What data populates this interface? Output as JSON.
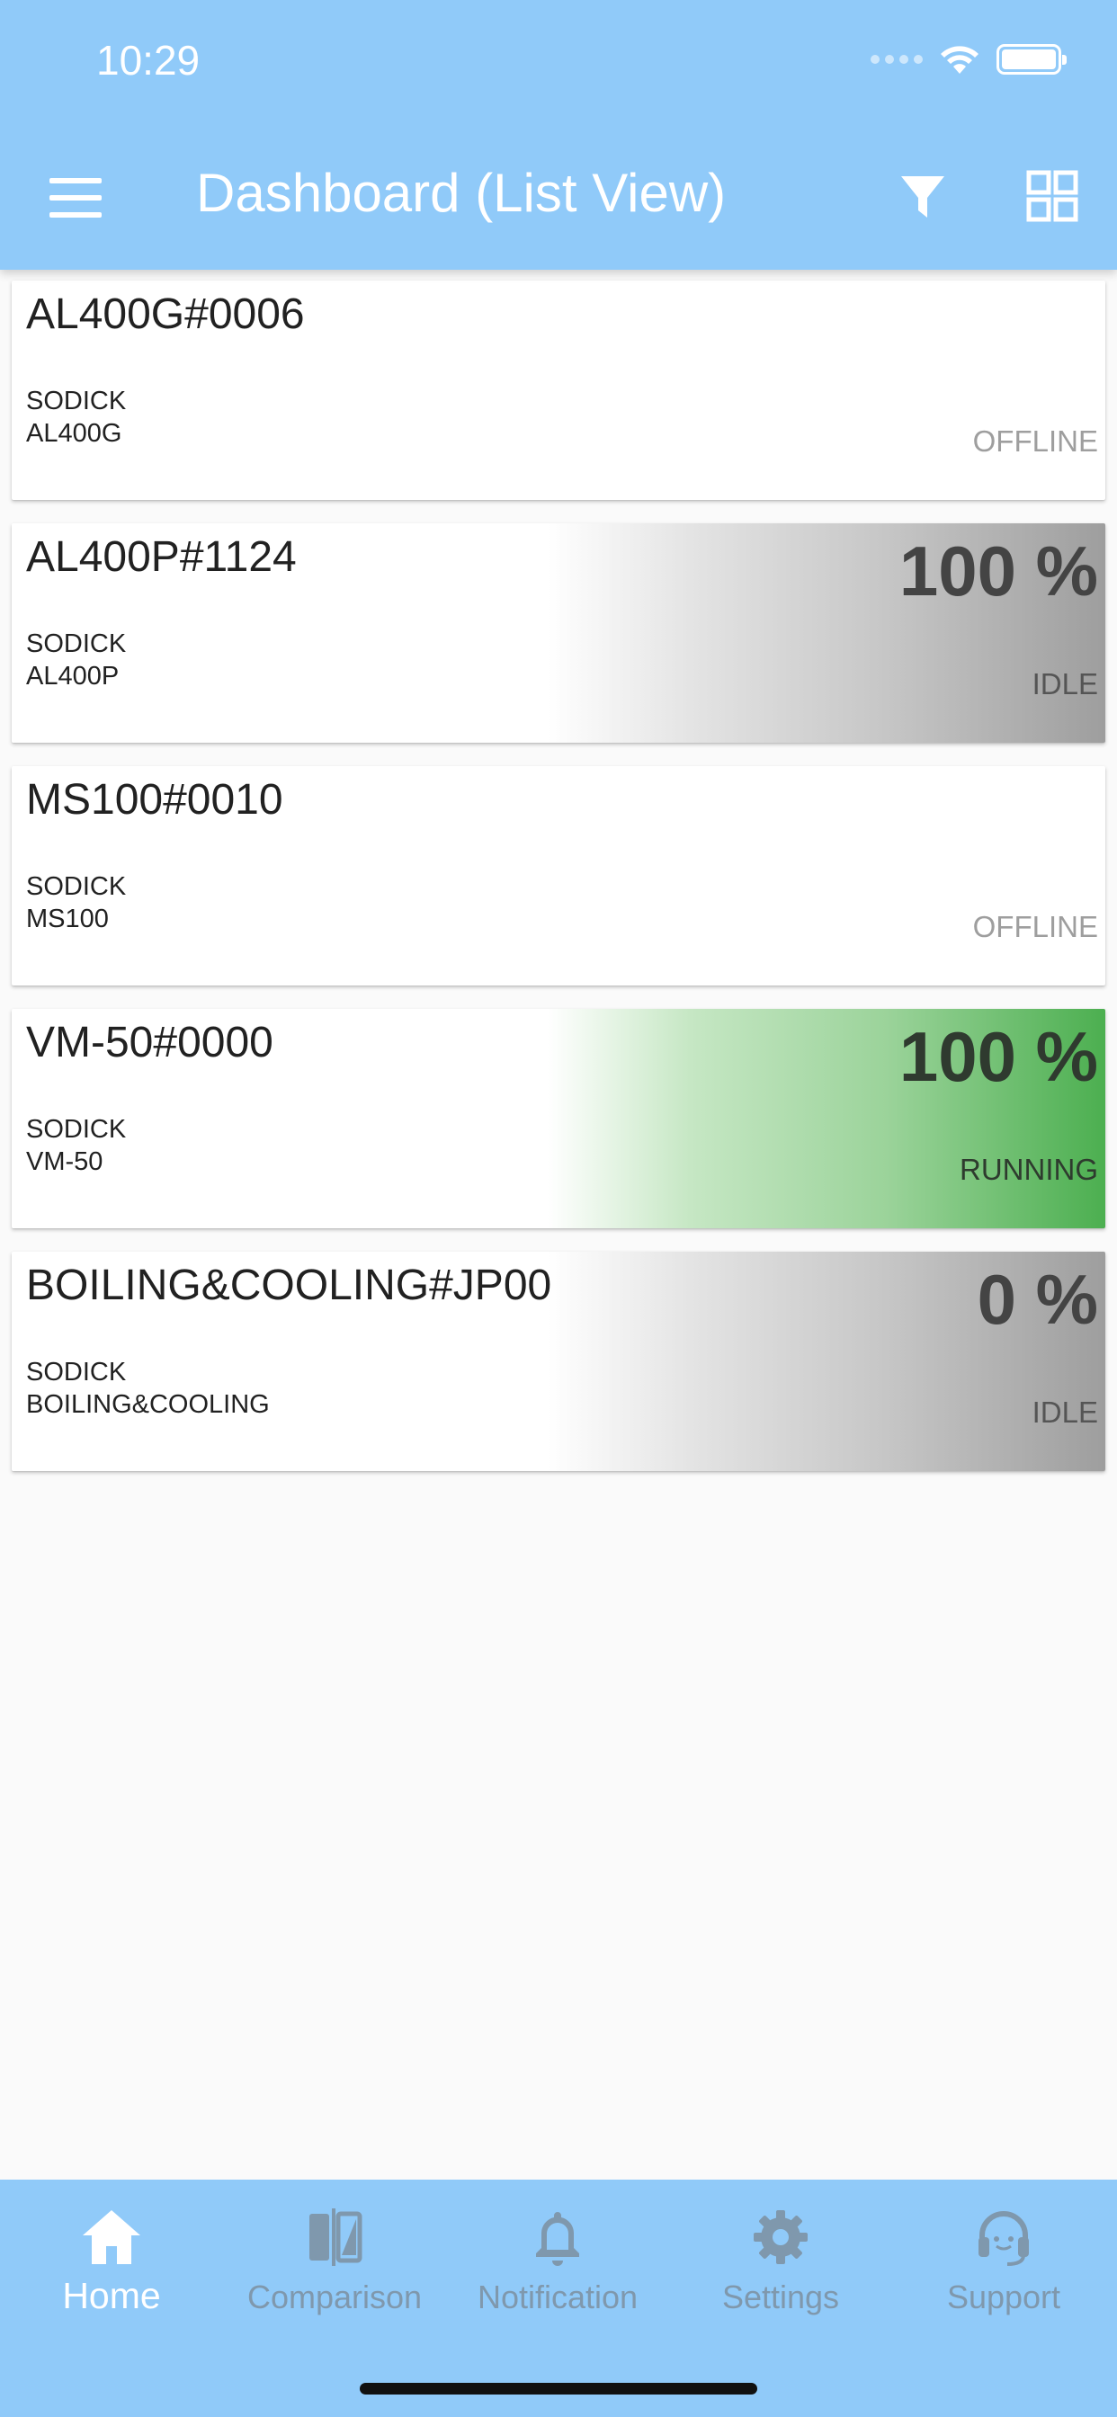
{
  "status_bar": {
    "time": "10:29"
  },
  "app_bar": {
    "title": "Dashboard (List View)",
    "menu_icon": "hamburger-menu-icon",
    "filter_icon": "filter-funnel-icon",
    "view_icon": "grid-view-icon"
  },
  "colors": {
    "primary": "#90caf9",
    "running": "#4caf50",
    "idle": "#9e9e9e",
    "background": "#fafafa"
  },
  "machines": [
    {
      "name": "AL400G#0006",
      "maker": "SODICK",
      "model": "AL400G",
      "percent": "",
      "status": "OFFLINE",
      "state": "offline"
    },
    {
      "name": "AL400P#1124",
      "maker": "SODICK",
      "model": "AL400P",
      "percent": "100 %",
      "status": "IDLE",
      "state": "idle"
    },
    {
      "name": "MS100#0010",
      "maker": "SODICK",
      "model": "MS100",
      "percent": "",
      "status": "OFFLINE",
      "state": "offline"
    },
    {
      "name": "VM-50#0000",
      "maker": "SODICK",
      "model": "VM-50",
      "percent": "100 %",
      "status": "RUNNING",
      "state": "running"
    },
    {
      "name": "BOILING&COOLING#JP00",
      "maker": "SODICK",
      "model": "BOILING&COOLING",
      "percent": "0 %",
      "status": "IDLE",
      "state": "idle"
    }
  ],
  "bottom_nav": {
    "items": [
      {
        "label": "Home",
        "icon": "home-icon",
        "active": true
      },
      {
        "label": "Comparison",
        "icon": "compare-icon",
        "active": false
      },
      {
        "label": "Notification",
        "icon": "bell-icon",
        "active": false
      },
      {
        "label": "Settings",
        "icon": "gear-icon",
        "active": false
      },
      {
        "label": "Support",
        "icon": "headset-icon",
        "active": false
      }
    ]
  }
}
